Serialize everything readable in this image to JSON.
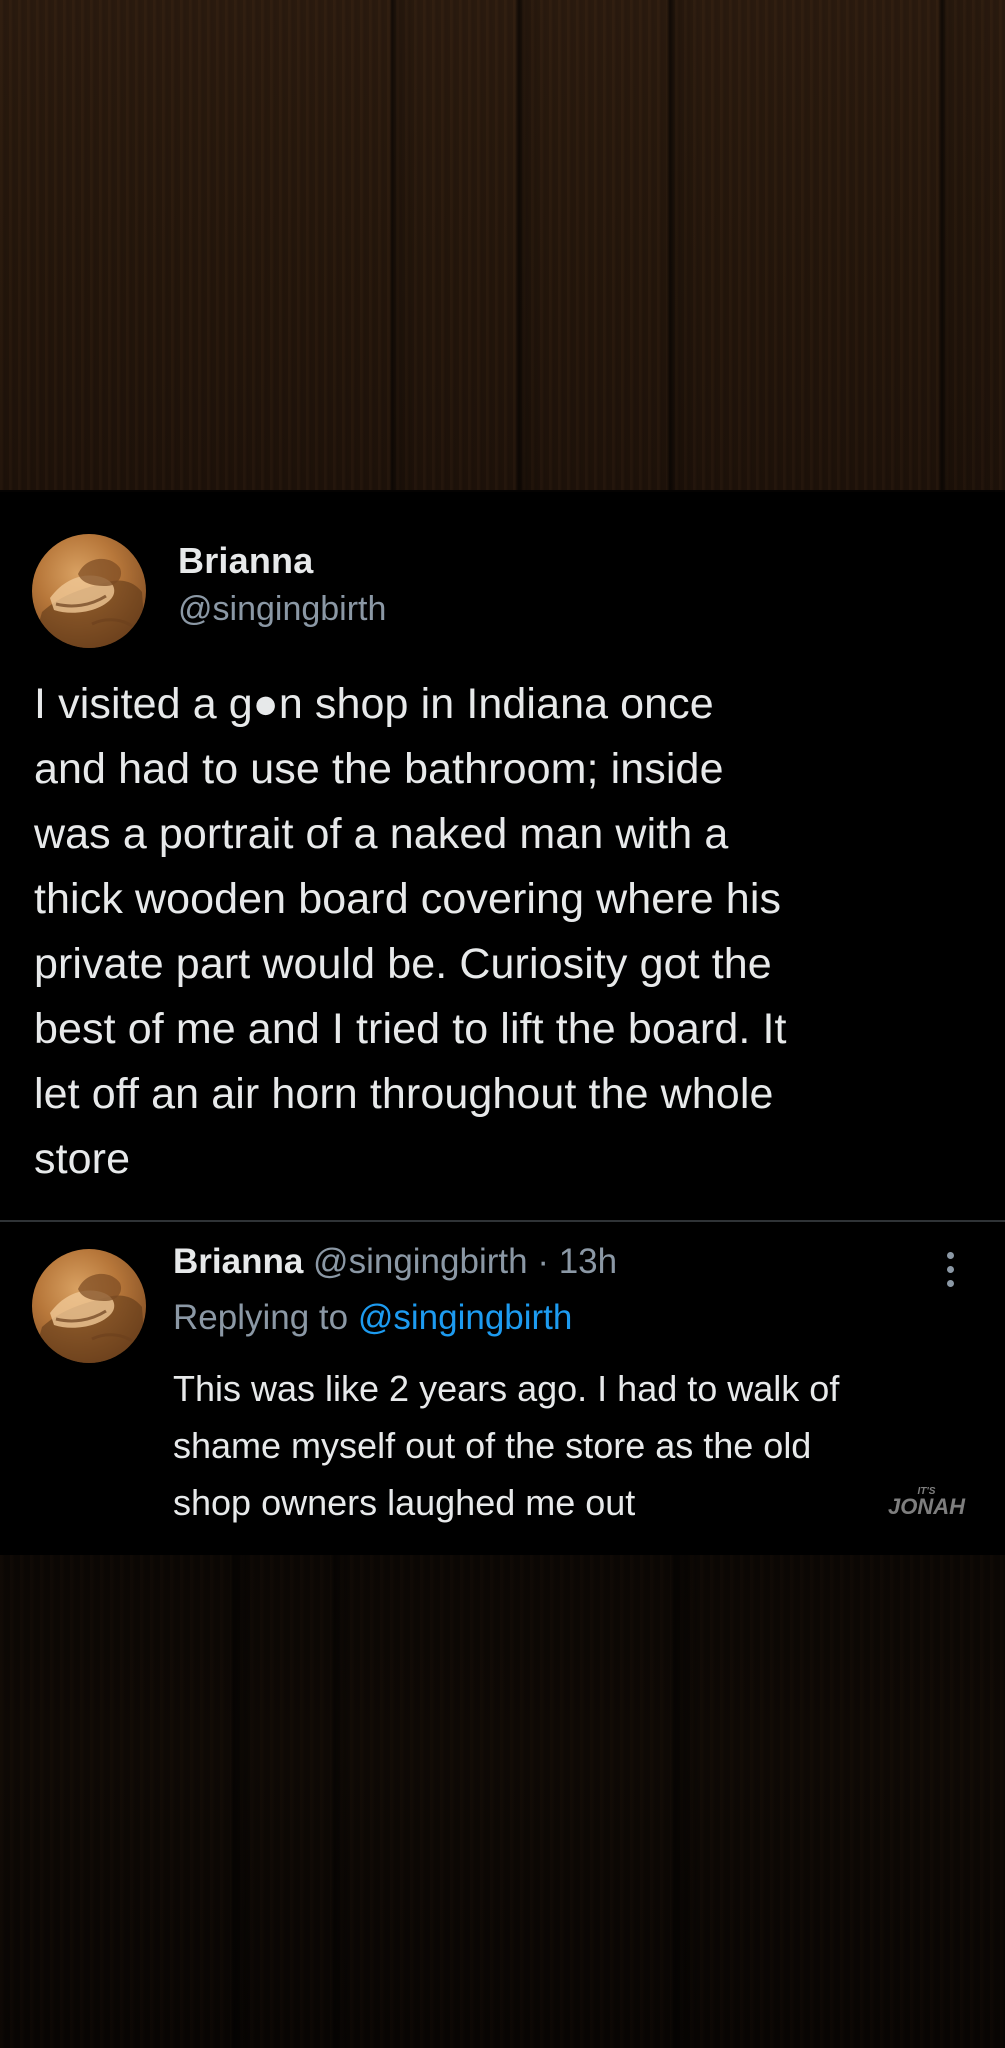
{
  "tweet": {
    "author_name": "Brianna",
    "author_handle": "@singingbirth",
    "text": "I visited a g●n shop in Indiana once\nand had to use the bathroom; inside\nwas a portrait of a naked man with a\nthick wooden board covering where his\nprivate part would be. Curiosity got the\nbest of me and I tried to lift the board. It\nlet off an air horn throughout the whole\nstore"
  },
  "reply": {
    "author_name": "Brianna",
    "author_handle": "@singingbirth",
    "separator": "·",
    "time": "13h",
    "replying_prefix": "Replying to",
    "replying_handle": "@singingbirth",
    "text": "This was like 2 years ago. I had to walk of\nshame myself out of the store as the old\nshop owners laughed me out"
  },
  "watermark": {
    "small": "IT'S",
    "large": "JONAH"
  },
  "icons": {
    "avatar": "avatar-image",
    "more": "more-options-icon"
  },
  "colors": {
    "card_background": "#000000",
    "primary_text": "#e7e9ea",
    "secondary_text": "#8b98a5",
    "link": "#1d9bf0",
    "divider": "#2f3336",
    "wood_background": "#24160b"
  }
}
